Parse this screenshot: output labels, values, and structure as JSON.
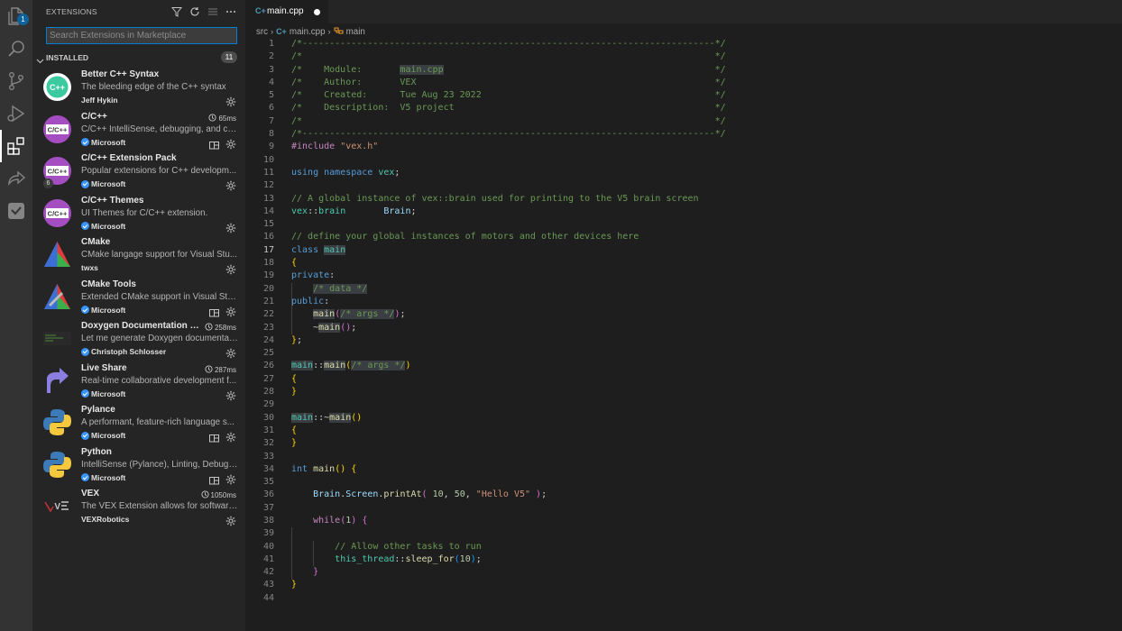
{
  "activity_bar": {
    "explorer_badge": "1",
    "icons": [
      "files-icon",
      "search-icon",
      "source-control-icon",
      "run-debug-icon",
      "extensions-icon",
      "live-share-icon",
      "vex-icon"
    ]
  },
  "sidebar": {
    "title": "EXTENSIONS",
    "search_placeholder": "Search Extensions in Marketplace",
    "installed_label": "INSTALLED",
    "installed_count": "11",
    "extensions": [
      {
        "name": "Better C++ Syntax",
        "timing": "",
        "desc": "The bleeding edge of the C++ syntax",
        "publisher": "Jeff Hykin",
        "verified": false,
        "workspace": false
      },
      {
        "name": "C/C++",
        "timing": "65ms",
        "desc": "C/C++ IntelliSense, debugging, and co...",
        "publisher": "Microsoft",
        "verified": true,
        "workspace": true
      },
      {
        "name": "C/C++ Extension Pack",
        "timing": "",
        "desc": "Popular extensions for C++ developm...",
        "publisher": "Microsoft",
        "verified": true,
        "workspace": false,
        "pack_count": "6"
      },
      {
        "name": "C/C++ Themes",
        "timing": "",
        "desc": "UI Themes for C/C++ extension.",
        "publisher": "Microsoft",
        "verified": true,
        "workspace": false
      },
      {
        "name": "CMake",
        "timing": "",
        "desc": "CMake langage support for Visual Stu...",
        "publisher": "twxs",
        "verified": false,
        "workspace": false
      },
      {
        "name": "CMake Tools",
        "timing": "",
        "desc": "Extended CMake support in Visual Stu...",
        "publisher": "Microsoft",
        "verified": true,
        "workspace": true
      },
      {
        "name": "Doxygen Documentation G...",
        "timing": "258ms",
        "desc": "Let me generate Doxygen documentat...",
        "publisher": "Christoph Schlosser",
        "verified": true,
        "workspace": false
      },
      {
        "name": "Live Share",
        "timing": "287ms",
        "desc": "Real-time collaborative development f...",
        "publisher": "Microsoft",
        "verified": true,
        "workspace": false
      },
      {
        "name": "Pylance",
        "timing": "",
        "desc": "A performant, feature-rich language s...",
        "publisher": "Microsoft",
        "verified": true,
        "workspace": true
      },
      {
        "name": "Python",
        "timing": "",
        "desc": "IntelliSense (Pylance), Linting, Debuggi...",
        "publisher": "Microsoft",
        "verified": true,
        "workspace": true
      },
      {
        "name": "VEX",
        "timing": "1050ms",
        "desc": "The VEX Extension allows for software ...",
        "publisher": "VEXRobotics",
        "verified": false,
        "workspace": false
      }
    ]
  },
  "tab": {
    "label": "main.cpp",
    "modified": true
  },
  "breadcrumb": {
    "folder": "src",
    "file": "main.cpp",
    "symbol": "main"
  },
  "editor": {
    "current_line": 17,
    "lines": [
      [
        [
          "c",
          "/*----------------------------------------------------------------------------*/"
        ]
      ],
      [
        [
          "c",
          "/*                                                                            */"
        ]
      ],
      [
        [
          "c",
          "/*    Module:       "
        ],
        [
          "ch",
          "main.cpp"
        ],
        [
          "c",
          "                                                  */"
        ]
      ],
      [
        [
          "c",
          "/*    Author:       VEX                                                       */"
        ]
      ],
      [
        [
          "c",
          "/*    Created:      Tue Aug 23 2022                                           */"
        ]
      ],
      [
        [
          "c",
          "/*    Description:  V5 project                                                */"
        ]
      ],
      [
        [
          "c",
          "/*                                                                            */"
        ]
      ],
      [
        [
          "c",
          "/*----------------------------------------------------------------------------*/"
        ]
      ],
      [
        [
          "p",
          "#include "
        ],
        [
          "s",
          "\"vex.h\""
        ]
      ],
      [],
      [
        [
          "k",
          "using"
        ],
        [
          "o",
          " "
        ],
        [
          "k",
          "namespace"
        ],
        [
          "o",
          " "
        ],
        [
          "t",
          "vex"
        ],
        [
          "o",
          ";"
        ]
      ],
      [],
      [
        [
          "c",
          "// A global instance of vex::brain used for printing to the V5 brain screen"
        ]
      ],
      [
        [
          "t",
          "vex"
        ],
        [
          "o",
          "::"
        ],
        [
          "t",
          "brain"
        ],
        [
          "o",
          "       "
        ],
        [
          "v",
          "Brain"
        ],
        [
          "o",
          ";"
        ]
      ],
      [],
      [
        [
          "c",
          "// define your global instances of motors and other devices here"
        ]
      ],
      [
        [
          "k",
          "class"
        ],
        [
          "o",
          " "
        ],
        [
          "th",
          "main"
        ]
      ],
      [
        [
          "b1",
          "{"
        ]
      ],
      [
        [
          "k",
          "private"
        ],
        [
          "o",
          ":"
        ]
      ],
      [
        [
          "o",
          "    "
        ],
        [
          "ch",
          "/* data */"
        ]
      ],
      [
        [
          "k",
          "public"
        ],
        [
          "o",
          ":"
        ]
      ],
      [
        [
          "o",
          "    "
        ],
        [
          "fh",
          "main"
        ],
        [
          "b2",
          "("
        ],
        [
          "ch",
          "/* args */"
        ],
        [
          "b2",
          ")"
        ],
        [
          "o",
          ";"
        ]
      ],
      [
        [
          "o",
          "    ~"
        ],
        [
          "fh",
          "main"
        ],
        [
          "b2",
          "()"
        ],
        [
          "o",
          ";"
        ]
      ],
      [
        [
          "b1",
          "}"
        ],
        [
          "o",
          ";"
        ]
      ],
      [],
      [
        [
          "th",
          "main"
        ],
        [
          "o",
          "::"
        ],
        [
          "fh",
          "main"
        ],
        [
          "b1",
          "("
        ],
        [
          "ch",
          "/* args */"
        ],
        [
          "b1",
          ")"
        ]
      ],
      [
        [
          "b1",
          "{"
        ]
      ],
      [
        [
          "b1",
          "}"
        ]
      ],
      [],
      [
        [
          "th",
          "main"
        ],
        [
          "o",
          "::~"
        ],
        [
          "fh",
          "main"
        ],
        [
          "b1",
          "()"
        ]
      ],
      [
        [
          "b1",
          "{"
        ]
      ],
      [
        [
          "b1",
          "}"
        ]
      ],
      [],
      [
        [
          "k",
          "int"
        ],
        [
          "o",
          " "
        ],
        [
          "f",
          "main"
        ],
        [
          "b1",
          "()"
        ],
        [
          "o",
          " "
        ],
        [
          "b1",
          "{"
        ]
      ],
      [],
      [
        [
          "o",
          "    "
        ],
        [
          "v",
          "Brain"
        ],
        [
          "o",
          "."
        ],
        [
          "v",
          "Screen"
        ],
        [
          "o",
          "."
        ],
        [
          "f",
          "printAt"
        ],
        [
          "b2",
          "("
        ],
        [
          "o",
          " "
        ],
        [
          "n",
          "10"
        ],
        [
          "o",
          ", "
        ],
        [
          "n",
          "50"
        ],
        [
          "o",
          ", "
        ],
        [
          "s",
          "\"Hello V5\""
        ],
        [
          "o",
          " "
        ],
        [
          "b2",
          ")"
        ],
        [
          "o",
          ";"
        ]
      ],
      [],
      [
        [
          "o",
          "    "
        ],
        [
          "x",
          "while"
        ],
        [
          "b2",
          "("
        ],
        [
          "n",
          "1"
        ],
        [
          "b2",
          ")"
        ],
        [
          "o",
          " "
        ],
        [
          "b2",
          "{"
        ]
      ],
      [],
      [
        [
          "o",
          "        "
        ],
        [
          "c",
          "// Allow other tasks to run"
        ]
      ],
      [
        [
          "o",
          "        "
        ],
        [
          "t",
          "this_thread"
        ],
        [
          "o",
          "::"
        ],
        [
          "f",
          "sleep_for"
        ],
        [
          "b3",
          "("
        ],
        [
          "n",
          "10"
        ],
        [
          "b3",
          ")"
        ],
        [
          "o",
          ";"
        ]
      ],
      [
        [
          "o",
          "    "
        ],
        [
          "b2",
          "}"
        ]
      ],
      [
        [
          "b1",
          "}"
        ]
      ],
      []
    ]
  }
}
